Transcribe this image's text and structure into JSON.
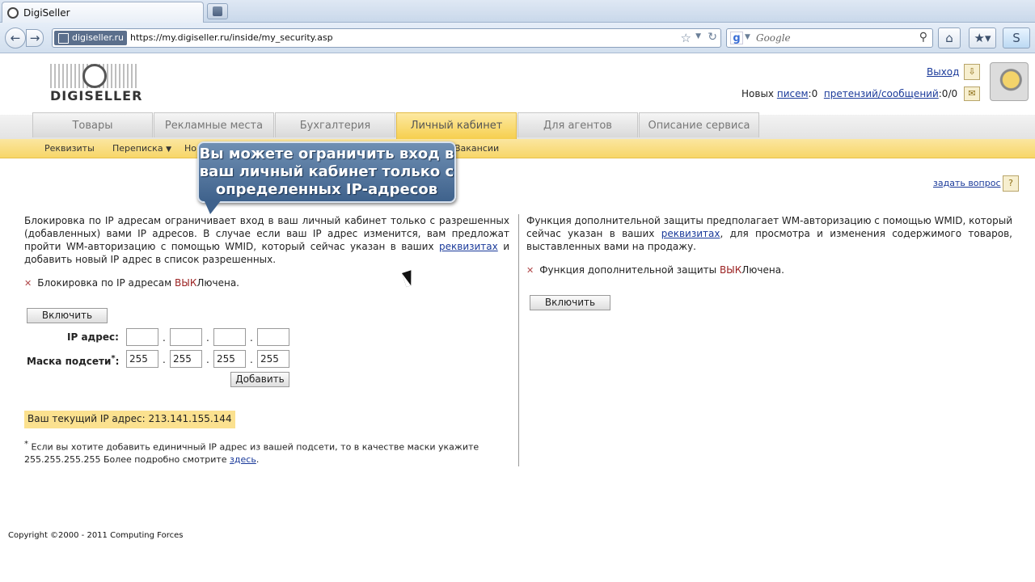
{
  "browser": {
    "tab_title": "DigiSeller",
    "site_identity": "digiseller.ru",
    "url": "https://my.digiseller.ru/inside/my_security.asp",
    "search_placeholder": "Google"
  },
  "header": {
    "logo_text": "DIGISELLER",
    "logout": "Выход",
    "new_prefix": "Новых",
    "letters_link": "писем",
    "letters_count": ":0",
    "claims_link": "претензий/сообщений",
    "claims_count": ":0/0"
  },
  "tabs": [
    {
      "label": "Товары"
    },
    {
      "label": "Рекламные места"
    },
    {
      "label": "Бухгалтерия"
    },
    {
      "label": "Личный кабинет",
      "active": true
    },
    {
      "label": "Для агентов"
    },
    {
      "label": "Описание сервиса"
    }
  ],
  "subnav": {
    "items": [
      "Реквизиты",
      "Переписка",
      "Но",
      "Вакансии"
    ]
  },
  "callout": {
    "lines": [
      "Вы можете ограничить вход в",
      "ваш личный кабинет только с",
      "определенных IP-адресов"
    ]
  },
  "ask": "задать вопрос",
  "left": {
    "para_1": "Блокировка по IP адресам ограничивает вход в ваш личный кабинет только с разрешенных (добавленных) вами IP адресов. В случае если ваш IP адрес изменится, вам предложат пройти WM-авторизацию с помощью WMID, который сейчас указан в ваших",
    "para_link": "реквизитах",
    "para_2": "и добавить новый IP адрес в список разрешенных.",
    "status_prefix": "Блокировка по IP адресам",
    "status_off": "ВЫК",
    "status_suffix": "Лючена.",
    "enable_button": "Включить",
    "ip_label": "IP адрес:",
    "mask_label": "Маска подсети",
    "mask_star": "*",
    "mask_colon": ":",
    "ip_values": [
      "",
      "",
      "",
      ""
    ],
    "mask_values": [
      "255",
      "255",
      "255",
      "255"
    ],
    "add_button": "Добавить",
    "current_ip": "Ваш текущий IP адрес: 213.141.155.144",
    "footnote_star": "*",
    "footnote_text": " Если вы хотите добавить единичный IP адрес из вашей подсети, то в качестве маски укажите 255.255.255.255 Более подробно смотрите ",
    "footnote_link": "здесь",
    "footnote_end": "."
  },
  "right": {
    "para_1": "Функция дополнительной защиты предполагает WM-авторизацию с помощью WMID, который сейчас указан в ваших",
    "para_link": "реквизитах",
    "para_2": ", для просмотра и изменения содержимого товаров, выставленных вами на продажу.",
    "status_prefix": "Функция дополнительной защиты",
    "status_off": "ВЫК",
    "status_suffix": "Лючена.",
    "enable_button": "Включить"
  },
  "footer": {
    "copyright": "Copyright ©2000 - 2011 Computing Forces"
  }
}
